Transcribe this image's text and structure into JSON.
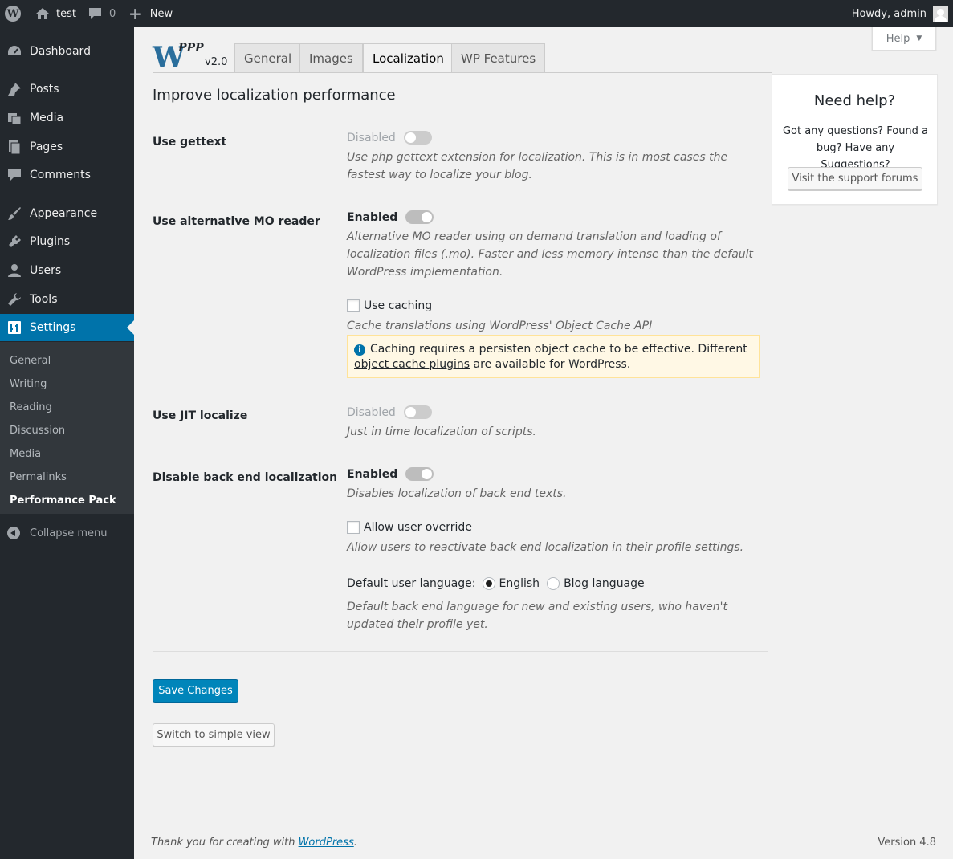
{
  "adminbar": {
    "site_name": "test",
    "comments_count": "0",
    "new_label": "New",
    "howdy": "Howdy, admin"
  },
  "sidebar": {
    "items": [
      {
        "label": "Dashboard",
        "icon": "dashboard-icon"
      },
      {
        "label": "Posts",
        "icon": "pin-icon"
      },
      {
        "label": "Media",
        "icon": "media-icon"
      },
      {
        "label": "Pages",
        "icon": "pages-icon"
      },
      {
        "label": "Comments",
        "icon": "comment-icon"
      },
      {
        "label": "Appearance",
        "icon": "brush-icon"
      },
      {
        "label": "Plugins",
        "icon": "plug-icon"
      },
      {
        "label": "Users",
        "icon": "user-icon"
      },
      {
        "label": "Tools",
        "icon": "wrench-icon"
      },
      {
        "label": "Settings",
        "icon": "settings-icon"
      }
    ],
    "submenu": [
      "General",
      "Writing",
      "Reading",
      "Discussion",
      "Media",
      "Permalinks",
      "Performance Pack"
    ],
    "collapse": "Collapse menu"
  },
  "help_tab": "Help",
  "logo": {
    "text": "PPP",
    "version": "v2.0"
  },
  "tabs": [
    "General",
    "Images",
    "Localization",
    "WP Features"
  ],
  "page": {
    "title": "Improve localization performance",
    "gettext": {
      "label": "Use gettext",
      "state": "Disabled",
      "desc": "Use php gettext extension for localization. This is in most cases the fastest way to localize your blog."
    },
    "mo_reader": {
      "label": "Use alternative MO reader",
      "state": "Enabled",
      "desc": "Alternative MO reader using on demand translation and loading of localization files (.mo). Faster and less memory intense than the default WordPress implementation.",
      "caching_label": "Use caching",
      "caching_desc": "Cache translations using WordPress' Object Cache API",
      "notice_pre": "Caching requires a persisten object cache to be effective. Different ",
      "notice_link": "object cache plugins",
      "notice_post": " are available for WordPress."
    },
    "jit": {
      "label": "Use JIT localize",
      "state": "Disabled",
      "desc": "Just in time localization of scripts."
    },
    "backend": {
      "label": "Disable back end localization",
      "state": "Enabled",
      "desc": "Disables localization of back end texts.",
      "override_label": "Allow user override",
      "override_desc": "Allow users to reactivate back end localization in their profile settings.",
      "lang_label": "Default user language:",
      "lang_options": [
        "English",
        "Blog language"
      ],
      "lang_desc": "Default back end language for new and existing users, who haven't updated their profile yet."
    },
    "save_button": "Save Changes",
    "simple_view_button": "Switch to simple view"
  },
  "helpbox": {
    "title": "Need help?",
    "text": "Got any questions? Found a bug? Have any Suggestions?",
    "button": "Visit the support forums"
  },
  "footer": {
    "thanks_pre": "Thank you for creating with ",
    "thanks_link": "WordPress",
    "thanks_post": ".",
    "version": "Version 4.8"
  }
}
